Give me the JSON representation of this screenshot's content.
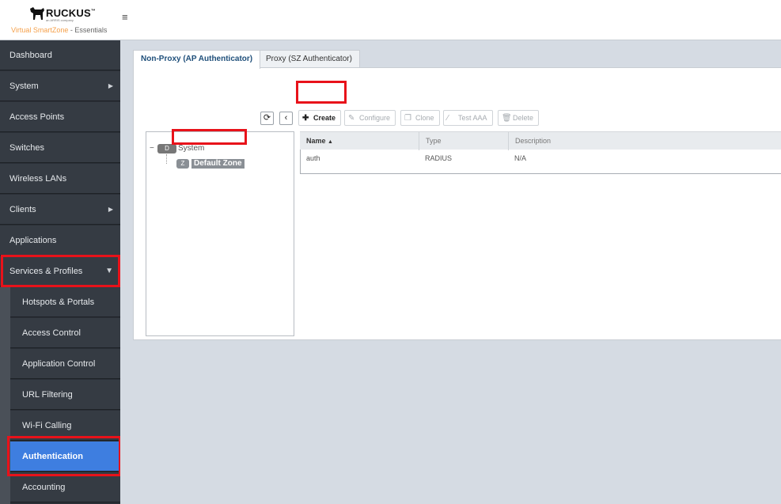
{
  "header": {
    "logo_text": "RUCKUS",
    "logo_tm": "™",
    "logo_sub": "an ARRIS company",
    "product": "Virtual SmartZone",
    "separator": " - ",
    "edition": "Essentials",
    "menu_icon": "hamburger-icon"
  },
  "sidebar": {
    "items": [
      {
        "label": "Dashboard"
      },
      {
        "label": "System",
        "arrow": "▶"
      },
      {
        "label": "Access Points"
      },
      {
        "label": "Switches"
      },
      {
        "label": "Wireless LANs"
      },
      {
        "label": "Clients",
        "arrow": "▶"
      },
      {
        "label": "Applications"
      },
      {
        "label": "Services & Profiles",
        "arrow": "▼"
      }
    ],
    "sub_items": [
      {
        "label": "Hotspots & Portals"
      },
      {
        "label": "Access Control"
      },
      {
        "label": "Application Control"
      },
      {
        "label": "URL Filtering"
      },
      {
        "label": "Wi-Fi Calling"
      },
      {
        "label": "Authentication",
        "active": true
      },
      {
        "label": "Accounting"
      }
    ]
  },
  "tabs": [
    {
      "label": "Non-Proxy (AP Authenticator)",
      "active": true
    },
    {
      "label": "Proxy (SZ Authenticator)",
      "active": false
    }
  ],
  "toolbar": {
    "create": "Create",
    "configure": "Configure",
    "clone": "Clone",
    "test_aaa": "Test AAA",
    "delete": "Delete"
  },
  "tree": {
    "root_toggle": "−",
    "root_badge": "D",
    "root_label": "System",
    "child_badge": "Z",
    "child_label": "Default Zone"
  },
  "grid": {
    "columns": [
      "Name",
      "Type",
      "Description"
    ],
    "sort_indicator": "▲",
    "rows": [
      [
        "auth",
        "RADIUS",
        "N/A"
      ]
    ]
  },
  "colors": {
    "highlight": "#e8121a",
    "active_nav": "#3e7ee0",
    "brand_orange": "#f5a04a"
  }
}
